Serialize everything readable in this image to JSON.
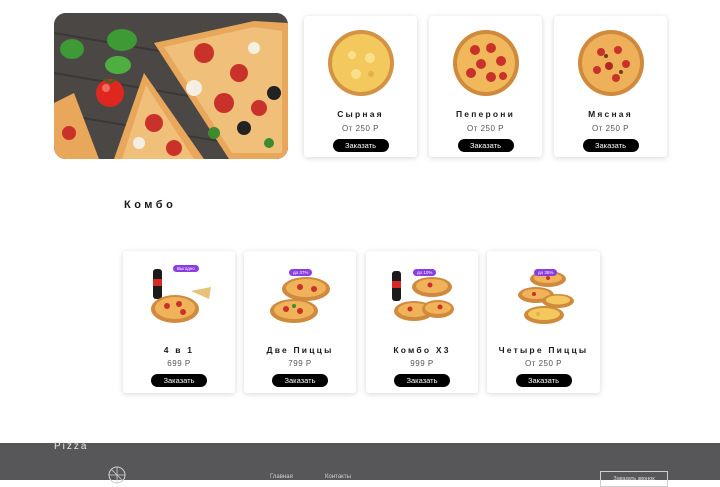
{
  "hero": {
    "alt": "pizza"
  },
  "pizzas": [
    {
      "name": "Сырная",
      "price": "От 250 Р",
      "button": "Заказать"
    },
    {
      "name": "Пеперони",
      "price": "От 250 Р",
      "button": "Заказать"
    },
    {
      "name": "Мясная",
      "price": "От 250 Р",
      "button": "Заказать"
    }
  ],
  "combo": {
    "title": "Комбо",
    "items": [
      {
        "name": "4 в 1",
        "price": "699 Р",
        "button": "Заказать",
        "badge": "Выгодно"
      },
      {
        "name": "Две Пиццы",
        "price": "799 Р",
        "button": "Заказать",
        "badge": "до 37%"
      },
      {
        "name": "Комбо Х3",
        "price": "999 Р",
        "button": "Заказать",
        "badge": "до 10%"
      },
      {
        "name": "Четыре Пиццы",
        "price": "От 250 Р",
        "button": "Заказать",
        "badge": "до 35%"
      }
    ]
  },
  "footer": {
    "logo": "Pizza",
    "links": [
      "Главная",
      "Контакты"
    ],
    "button": "Заказать звонок"
  },
  "colors": {
    "button_bg": "#000000",
    "badge_bg": "#8a3de0",
    "footer_bg": "#57575a",
    "crust": "#e8a75a",
    "pepperoni": "#c9322a"
  }
}
